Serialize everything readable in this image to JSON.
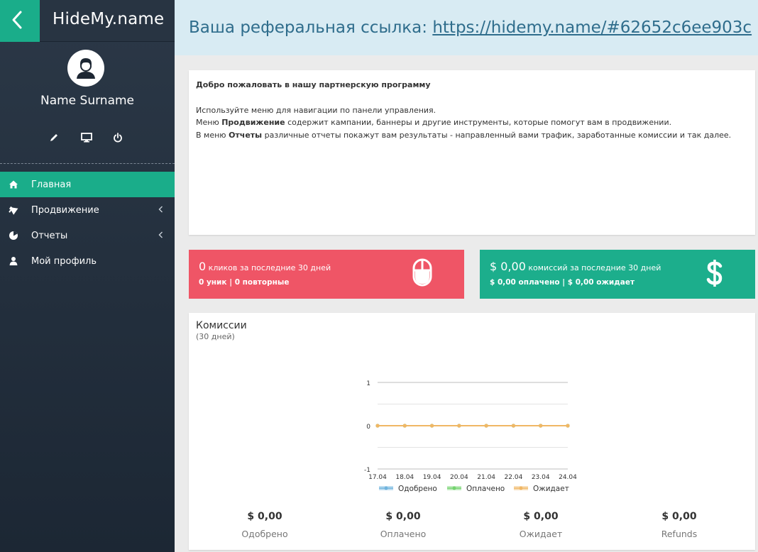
{
  "sidebar": {
    "logo": "HideMy.name",
    "user_name": "Name Surname",
    "nav": [
      {
        "label": "Главная",
        "icon": "home-icon",
        "active": true
      },
      {
        "label": "Продвижение",
        "icon": "bullhorn-icon",
        "has_submenu": true
      },
      {
        "label": "Отчеты",
        "icon": "pie-chart-icon",
        "has_submenu": true
      },
      {
        "label": "Мой профиль",
        "icon": "user-icon"
      }
    ]
  },
  "header": {
    "label": "Ваша реферальная ссылка: ",
    "link": "https://hidemy.name/#62652c6ee903c"
  },
  "welcome": {
    "title": "Добро пожаловать в нашу партнерскую программу",
    "line1": "Используйте меню для навигации по панели управления.",
    "line2_pre": "Меню ",
    "line2_bold": "Продвижение",
    "line2_post": " содержит кампании, баннеры и другие инструменты, которые помогут вам в продвижении.",
    "line3_pre": "В меню ",
    "line3_bold": "Отчеты",
    "line3_post": " различные отчеты покажут вам результаты - направленный вами трафик, заработанные комиссии и так далее."
  },
  "stats": {
    "clicks": {
      "value": "0",
      "label": " кликов за последние 30 дней",
      "unique": "0 уник",
      "sep": " | ",
      "repeat": "0 повторные"
    },
    "commissions": {
      "value": "$ 0,00",
      "label": " комиссий за последние 30 дней",
      "paid": "$ 0,00 оплачено",
      "sep": " | ",
      "pending": "$ 0,00 ожидает"
    }
  },
  "commissions": {
    "title": "Комиссии",
    "subtitle": "(30 дней)",
    "summary": [
      {
        "value": "$ 0,00",
        "label": "Одобрено"
      },
      {
        "value": "$ 0,00",
        "label": "Оплачено"
      },
      {
        "value": "$ 0,00",
        "label": "Ожидает"
      },
      {
        "value": "$ 0,00",
        "label": "Refunds"
      }
    ]
  },
  "colors": {
    "accent": "#1aad8a",
    "clicks_box": "#ef5566",
    "commissions_box": "#1cae8c",
    "header_bg": "#d8ebf3",
    "link": "#2f6d8c"
  },
  "chart_data": {
    "type": "line",
    "x": [
      "17.04",
      "18.04",
      "19.04",
      "20.04",
      "21.04",
      "22.04",
      "23.04",
      "24.04"
    ],
    "ylim": [
      -1,
      1
    ],
    "yticks": [
      1,
      0,
      -1
    ],
    "grid": true,
    "legend": "bottom",
    "series": [
      {
        "name": "Одобрено",
        "color": "#6fb3dd",
        "values": [
          0,
          0,
          0,
          0,
          0,
          0,
          0,
          0
        ]
      },
      {
        "name": "Оплачено",
        "color": "#74d36f",
        "values": [
          0,
          0,
          0,
          0,
          0,
          0,
          0,
          0
        ]
      },
      {
        "name": "Ожидает",
        "color": "#f0b765",
        "values": [
          0,
          0,
          0,
          0,
          0,
          0,
          0,
          0
        ]
      }
    ]
  }
}
